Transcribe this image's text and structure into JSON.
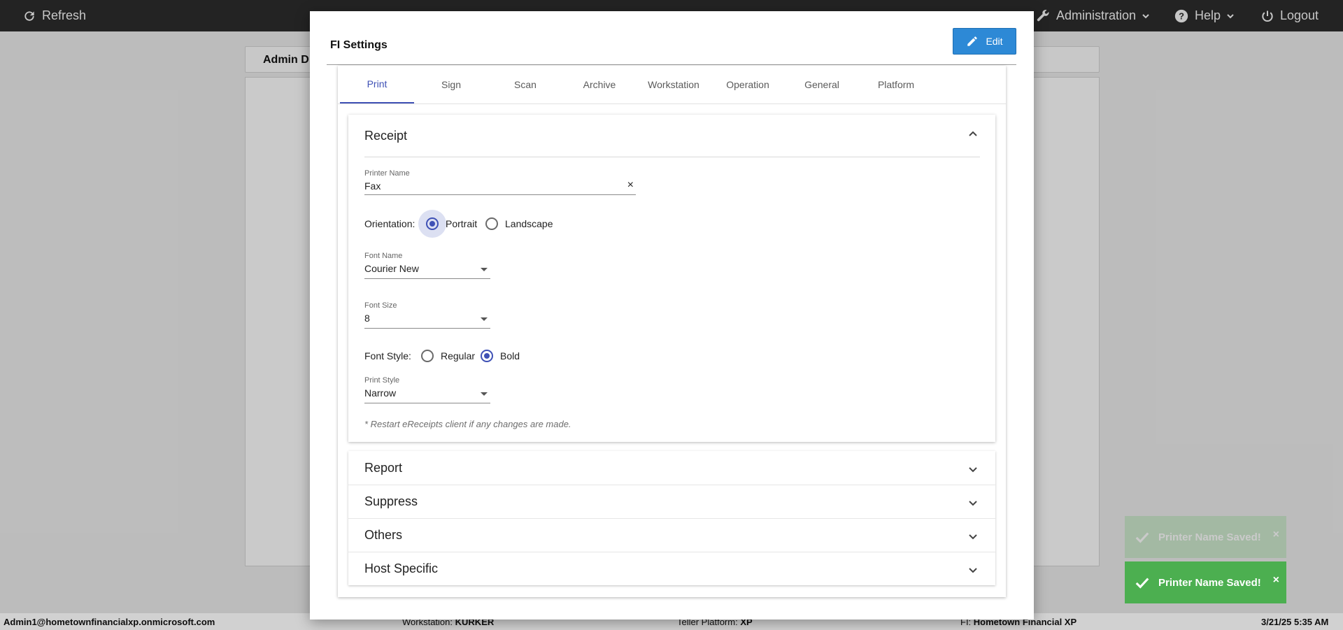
{
  "topbar": {
    "refresh_label": "Refresh",
    "administration_label": "Administration",
    "help_label": "Help",
    "logout_label": "Logout"
  },
  "background": {
    "admin_tab_label": "Admin D"
  },
  "modal": {
    "title": "FI Settings",
    "edit_label": "Edit",
    "tabs": [
      {
        "label": "Print",
        "active": true
      },
      {
        "label": "Sign"
      },
      {
        "label": "Scan"
      },
      {
        "label": "Archive"
      },
      {
        "label": "Workstation"
      },
      {
        "label": "Operation"
      },
      {
        "label": "General"
      },
      {
        "label": "Platform"
      }
    ],
    "receipt": {
      "title": "Receipt",
      "printer_name_label": "Printer Name",
      "printer_name_value": "Fax",
      "clear_glyph": "×",
      "orientation_label": "Orientation:",
      "orientation_options": [
        "Portrait",
        "Landscape"
      ],
      "orientation_selected": "Portrait",
      "font_name_label": "Font Name",
      "font_name_value": "Courier New",
      "font_size_label": "Font Size",
      "font_size_value": "8",
      "font_style_label": "Font Style:",
      "font_style_options": [
        "Regular",
        "Bold"
      ],
      "font_style_selected": "Bold",
      "print_style_label": "Print Style",
      "print_style_value": "Narrow",
      "note": "* Restart eReceipts client if any changes are made."
    },
    "sections": [
      "Report",
      "Suppress",
      "Others",
      "Host Specific"
    ]
  },
  "toasts": [
    {
      "message": "Printer Name Saved!",
      "close": "×",
      "faded": true
    },
    {
      "message": "Printer Name Saved!",
      "close": "×",
      "faded": false
    }
  ],
  "footer": {
    "user": "Admin1@hometownfinancialxp.onmicrosoft.com",
    "workstation_label": "Workstation:",
    "workstation_value": "KURKER",
    "platform_label": "Teller Platform:",
    "platform_value": "XP",
    "fi_label": "FI:",
    "fi_value": "Hometown Financial XP",
    "datetime": "3/21/25 5:35 AM"
  },
  "colors": {
    "accent": "#3f51b5",
    "edit_button": "#2d89d6",
    "toast_success": "#4caf50",
    "topbar": "#2b2b2b"
  }
}
